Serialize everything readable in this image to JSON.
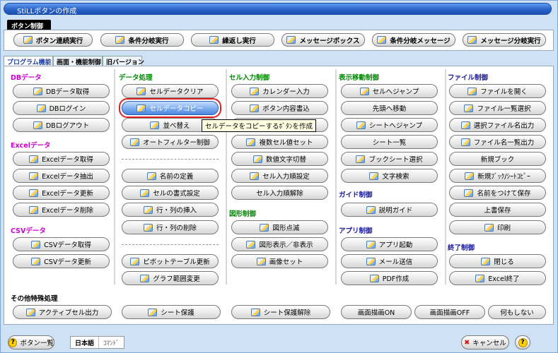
{
  "window": {
    "title": "StiLLボタンの作成"
  },
  "button_control": {
    "header": "ボタン制御",
    "buttons": [
      "ボタン連続実行",
      "条件分岐実行",
      "繰返し実行",
      "メッセージボックス",
      "条件分岐メッセージ",
      "メッセージ分岐実行"
    ]
  },
  "tabs": [
    "プログラム機能",
    "画面・機能制御",
    "旧バージョン"
  ],
  "sections": {
    "db": {
      "title": "DBデータ",
      "items": [
        "DBデータ取得",
        "DBログイン",
        "DBログアウト"
      ]
    },
    "excel": {
      "title": "Excelデータ",
      "items": [
        "Excelデータ取得",
        "Excelデータ抽出",
        "Excelデータ更新",
        "Excelデータ削除"
      ]
    },
    "csv": {
      "title": "CSVデータ",
      "items": [
        "CSVデータ取得",
        "CSVデータ更新"
      ]
    },
    "data": {
      "title": "データ処理",
      "items": [
        "セルデータクリア",
        "セルデータコピー",
        "並べ替え",
        "オートフィルター制御",
        "名前の定義",
        "セルの書式設定",
        "行・列の挿入",
        "行・列の削除",
        "ピボットテーブル更新",
        "グラフ範囲変更"
      ]
    },
    "cell_input": {
      "title": "セル入力制御",
      "items": [
        "カレンダー入力",
        "ボタン内容書込",
        "複数セル値セット",
        "数値文字切替",
        "セル入力順設定",
        "セル入力順解除"
      ]
    },
    "shape": {
      "title": "図形制御",
      "items": [
        "図形点滅",
        "図形表示／非表示",
        "画像セット"
      ]
    },
    "move": {
      "title": "表示移動制御",
      "items": [
        "セルへジャンプ",
        "先頭へ移動",
        "シートへジャンプ",
        "シート一覧",
        "ブックシート選択",
        "文字検索"
      ]
    },
    "guide": {
      "title": "ガイド制御",
      "items": [
        "説明ガイド"
      ]
    },
    "app": {
      "title": "アプリ制御",
      "items": [
        "アプリ起動",
        "メール送信",
        "PDF作成"
      ]
    },
    "file": {
      "title": "ファイル制御",
      "items": [
        "ファイルを開く",
        "ファイル一覧選択",
        "選択ファイル名出力",
        "ファイル名一覧出力",
        "新規ブック",
        "新規ﾌﾞｯｸ/ｼｰﾄｺﾋﾟｰ",
        "名前をつけて保存",
        "上書保存",
        "印刷"
      ]
    },
    "end": {
      "title": "終了制御",
      "items": [
        "閉じる",
        "Excel終了"
      ]
    },
    "other": {
      "title": "その他特殊処理",
      "items": [
        "アクティブセル出力",
        "シート保護",
        "シート保護解除",
        "画面描画ON",
        "画面描画OFF",
        "何もしない"
      ]
    }
  },
  "tooltip": "セルデータをコピーするﾎﾞﾀﾝを作成",
  "footer": {
    "list_button": "ボタン一覧",
    "lang_ja": "日本語",
    "lang_cmd": "ｺﾏﾝﾄﾞ",
    "cancel": "キャンセル",
    "help": "?"
  }
}
